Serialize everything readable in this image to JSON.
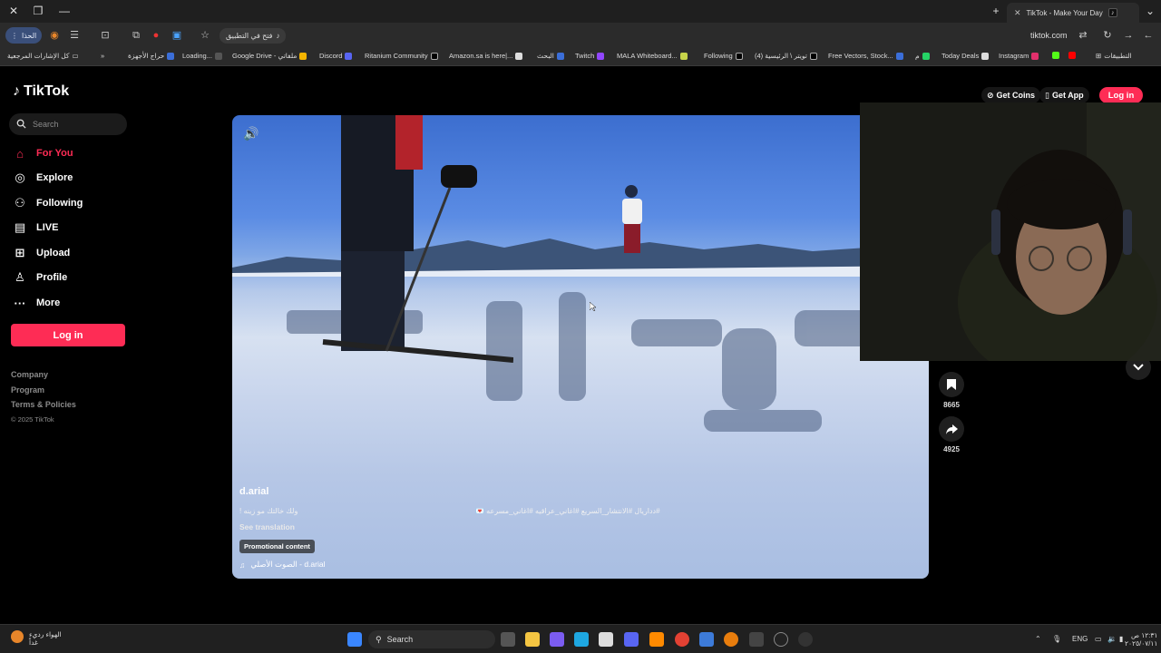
{
  "browser": {
    "tab_title": "TikTok - Make Your Day",
    "open_in_app_chip": "فتح في التطبيق",
    "profile_label": "الحذا",
    "url": "tiktok.com",
    "bookmarks": [
      "كل الإشارات المرجعية",
      "حراج الأجهزة",
      "Loading...",
      "Google Drive - ملفاتي",
      "Discord",
      "Ritanium Community",
      "Amazon.sa is here|...",
      "البحث",
      "Twitch",
      "MALA Whiteboard...",
      "Following",
      "تويتر \\ الرئيسية (4)",
      "Free Vectors, Stock...",
      "م",
      "Today Deals",
      "Instagram",
      "التطبيقات"
    ],
    "bookmarks_overflow": "»"
  },
  "tiktok": {
    "logo_text": "TikTok",
    "search_placeholder": "Search",
    "nav": [
      {
        "label": "For You",
        "icon": "home-icon",
        "active": true
      },
      {
        "label": "Explore",
        "icon": "compass-icon",
        "active": false
      },
      {
        "label": "Following",
        "icon": "following-icon",
        "active": false
      },
      {
        "label": "LIVE",
        "icon": "live-icon",
        "active": false
      },
      {
        "label": "Upload",
        "icon": "upload-icon",
        "active": false
      },
      {
        "label": "Profile",
        "icon": "profile-icon",
        "active": false
      },
      {
        "label": "More",
        "icon": "more-icon",
        "active": false
      }
    ],
    "login_button": "Log in",
    "footer_links": [
      "Company",
      "Program",
      "Terms & Policies"
    ],
    "copyright": "© 2025 TikTok",
    "header": {
      "get_coins": "Get Coins",
      "get_app": "Get App",
      "login": "Log in"
    },
    "video": {
      "author": "d.arial",
      "caption": "ولك خالتك مو زينه !",
      "hashtags": "#دداريال #الانتشار_السريع #اغاني_عراقيه #اغاني_مسرعه 💌",
      "see_translation": "See translation",
      "promo_badge": "Promotional content",
      "sound": "الصوت الأصلي - d.arial"
    },
    "actions": {
      "partial_count": "...",
      "bookmarks": "8665",
      "shares": "4925"
    }
  },
  "taskbar": {
    "weather_line1": "الهواء رديء",
    "weather_line2": "غداً",
    "search": "Search",
    "lang": "ENG",
    "time": "١٢:٣١ ص",
    "date": "٢٠٢٥/٠٧/١١"
  },
  "colors": {
    "accent": "#fe2c55",
    "bg": "#000000",
    "chrome": "#2b2b2b"
  }
}
